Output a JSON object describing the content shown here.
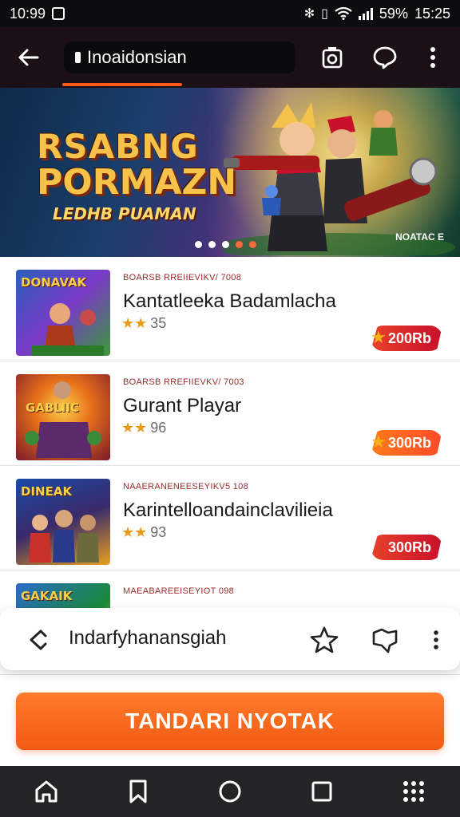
{
  "status_bar": {
    "time": "10:99",
    "battery": "59%",
    "clock": "15:25"
  },
  "app_bar": {
    "tab_title": "Inoaidonsian"
  },
  "banner": {
    "title_line1": "RSABNG",
    "title_line2": "PORMAZN",
    "subtitle": "LEDHB PUAMAN",
    "tag": "NOATAC E",
    "dots": [
      true,
      false,
      false,
      false,
      false
    ]
  },
  "games": [
    {
      "thumb_text": "DONAVAK",
      "meta": "BOARSB RREIIEVIKV/ 7008",
      "name": "Kantatleeka Badamlacha",
      "rating": "35",
      "price": "200Rb",
      "price_style": "red",
      "thumb_colors": [
        "#2a5fb8",
        "#3a9a3a",
        "#7a3ac8"
      ]
    },
    {
      "thumb_text": "GABLIIC",
      "meta": "BOARSB RREFIIEVKV/ 7003",
      "name": "Gurant Playar",
      "rating": "96",
      "price": "300Rb",
      "price_style": "orange",
      "thumb_colors": [
        "#f0a020",
        "#c0401a",
        "#5a1a4a"
      ]
    },
    {
      "thumb_text": "DINEAK",
      "meta": "NAAERANENEESEYIKV5 108",
      "name": "Karintelloandainclavilieia",
      "rating": "93",
      "price": "300Rb",
      "price_style": "red",
      "thumb_colors": [
        "#1a4aa8",
        "#e8a020",
        "#3a2a6a"
      ]
    },
    {
      "thumb_text": "GAKAIK",
      "meta": "MAEABAREEISEYIOT 098",
      "name": "",
      "rating": "",
      "price": "",
      "price_style": "red",
      "thumb_colors": [
        "#2a6ac8",
        "#f0c020",
        "#1a8a3a"
      ]
    }
  ],
  "url_bar": {
    "text": "Indarfyhanansgiah"
  },
  "action_button": {
    "label": "TANDARI NYOTAK"
  },
  "icons": {
    "back": "back-arrow-icon",
    "camera": "camera-icon",
    "chat": "chat-bubble-icon",
    "more": "more-vert-icon",
    "share": "share-icon",
    "bookmark_star": "star-icon",
    "thumb": "thumbs-icon",
    "home": "home-icon",
    "bookmark": "bookmark-icon",
    "circle": "home-circle-icon",
    "square": "recents-icon",
    "apps": "apps-grid-icon"
  },
  "colors": {
    "accent": "#f25a14",
    "app_bar_bg": "#1b1016",
    "price_red": "#c8102a"
  }
}
